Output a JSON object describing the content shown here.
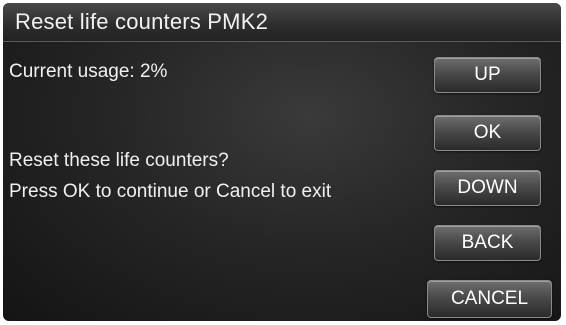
{
  "title": "Reset life counters PMK2",
  "usage_text": "Current usage: 2%",
  "prompt_line1": "Reset these life counters?",
  "prompt_line2": "Press OK to continue or Cancel to exit",
  "buttons": {
    "up": "UP",
    "ok": "OK",
    "down": "DOWN",
    "back": "BACK",
    "cancel": "CANCEL"
  },
  "colors": {
    "background": "#262626",
    "text": "#f0f0f0",
    "button_border": "#8a8a8a"
  }
}
